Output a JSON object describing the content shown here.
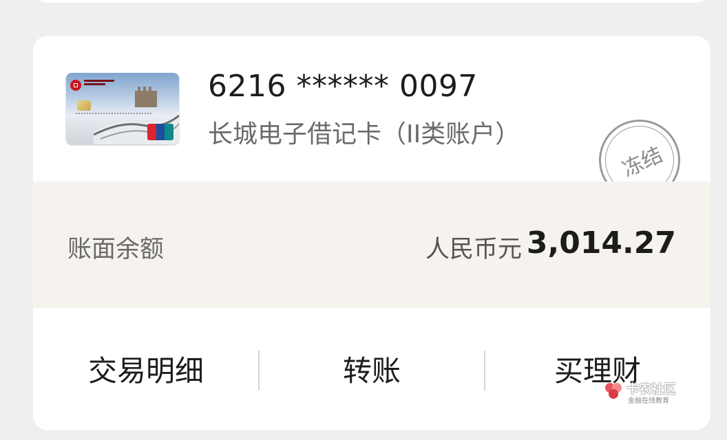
{
  "account": {
    "card_number": "6216 ****** 0097",
    "card_type": "长城电子借记卡（II类账户）",
    "status_stamp": "冻结",
    "card_image_icon": "boc-great-wall-card-icon"
  },
  "balance": {
    "label": "账面余额",
    "currency": "人民币元",
    "amount": "3,014.27"
  },
  "actions": [
    {
      "label": "交易明细"
    },
    {
      "label": "转账"
    },
    {
      "label": "买理财"
    }
  ],
  "watermark": {
    "title": "卡农社区",
    "subtitle": "金融在线教育"
  },
  "colors": {
    "background": "#efefef",
    "card": "#ffffff",
    "balance_band": "#f6f3ee",
    "stamp": "#9a9a9a"
  }
}
